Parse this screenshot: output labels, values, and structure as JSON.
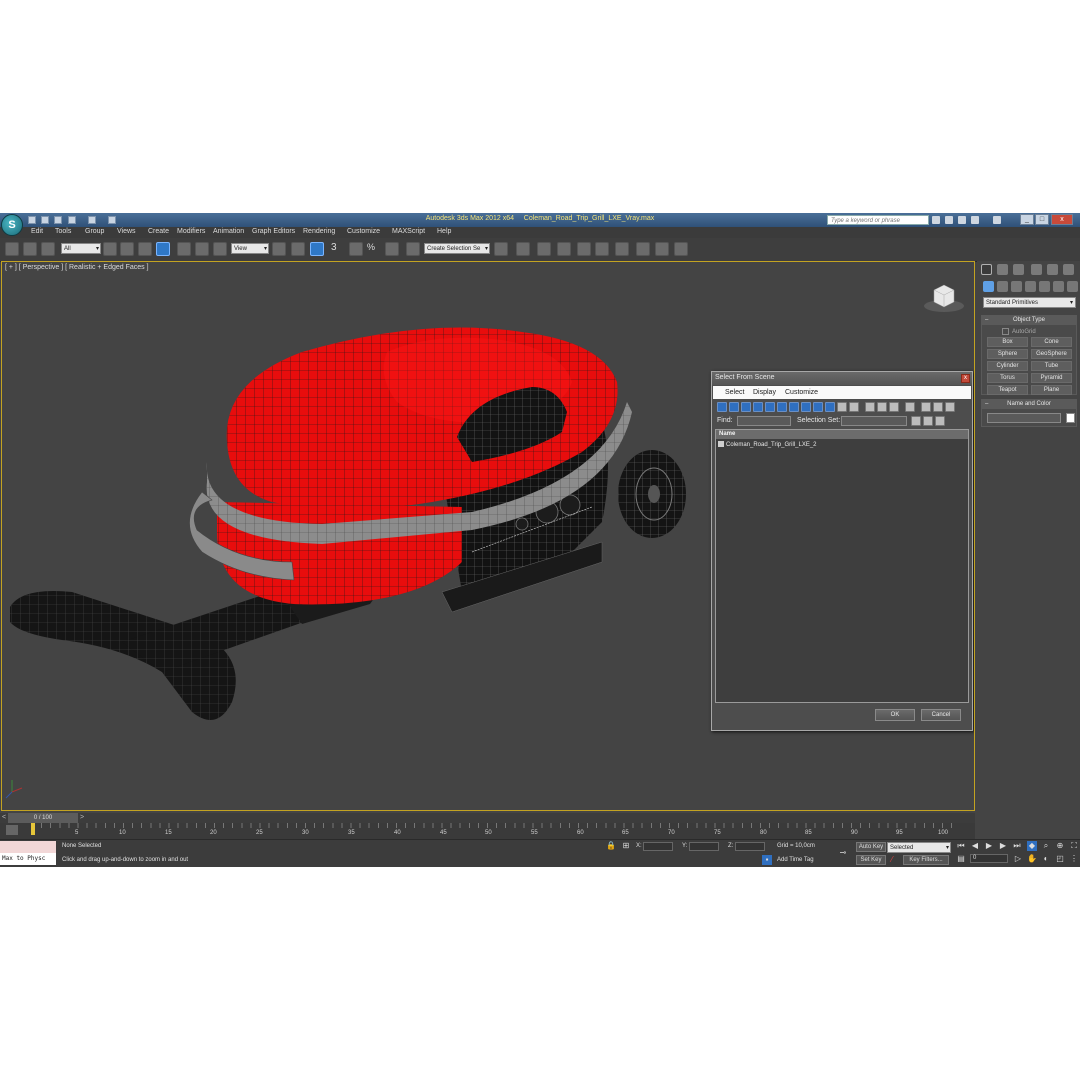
{
  "title_bar": {
    "app_title": "Autodesk 3ds Max  2012 x64",
    "file_name": "Coleman_Road_Trip_Grill_LXE_Vray.max",
    "search_placeholder": "Type a keyword or phrase",
    "logo_glyph": "S"
  },
  "menu": [
    "Edit",
    "Tools",
    "Group",
    "Views",
    "Create",
    "Modifiers",
    "Animation",
    "Graph Editors",
    "Rendering",
    "Customize",
    "MAXScript",
    "Help"
  ],
  "toolbar": {
    "selection_filter": "All",
    "reference_coord": "View",
    "named_selection": "Create Selection Se",
    "snap_3": "3",
    "snap_percent": "%"
  },
  "viewport": {
    "label": "[ + ] [ Perspective ] [ Realistic + Edged Faces ]",
    "accent_color": "#c3a321",
    "object_color": "#e80d0d"
  },
  "dialog": {
    "title": "Select From Scene",
    "close_label": "x",
    "menu": [
      "Select",
      "Display",
      "Customize"
    ],
    "find_label": "Find:",
    "selection_set_label": "Selection Set:",
    "column_name": "Name",
    "rows": [
      "Coleman_Road_Trip_Grill_LXE_2"
    ],
    "ok_label": "OK",
    "cancel_label": "Cancel"
  },
  "command_panel": {
    "category": "Standard Primitives",
    "object_type_title": "Object Type",
    "autogrid_label": "AutoGrid",
    "primitives": [
      "Box",
      "Cone",
      "Sphere",
      "GeoSphere",
      "Cylinder",
      "Tube",
      "Torus",
      "Pyramid",
      "Teapot",
      "Plane"
    ],
    "name_color_title": "Name and Color"
  },
  "timeline": {
    "frame_display": "0 / 100",
    "ticks": [
      "5",
      "10",
      "15",
      "20",
      "25",
      "30",
      "35",
      "40",
      "45",
      "50",
      "55",
      "60",
      "65",
      "70",
      "75",
      "80",
      "85",
      "90",
      "95",
      "100"
    ],
    "prev_arrow": "<",
    "next_arrow": ">"
  },
  "status": {
    "maxscript_text": "Max to Physc",
    "selection_status": "None Selected",
    "prompt": "Click and drag up-and-down to zoom in and out",
    "x_label": "X:",
    "y_label": "Y:",
    "z_label": "Z:",
    "grid": "Grid = 10,0cm",
    "add_time_tag": "Add Time Tag",
    "auto_key": "Auto Key",
    "auto_key_mode": "Selected",
    "set_key": "Set Key",
    "key_filters": "Key Filters...",
    "current_frame": "0"
  }
}
